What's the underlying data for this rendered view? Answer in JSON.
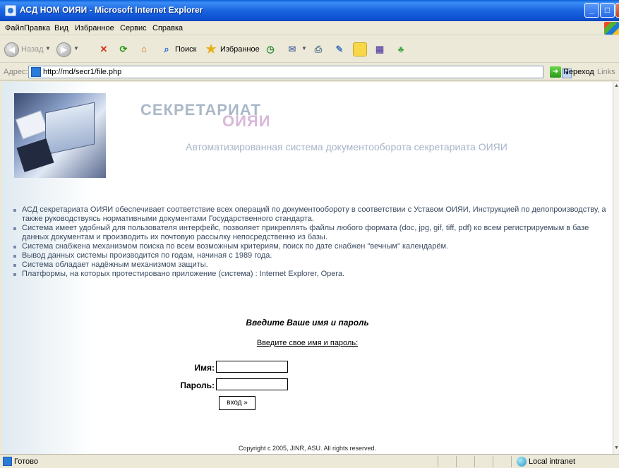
{
  "window": {
    "title": "АСД НОМ ОИЯИ - Microsoft Internet Explorer"
  },
  "menu": {
    "items": [
      "Файл",
      "Правка",
      "Вид",
      "Избранное",
      "Сервис",
      "Справка"
    ]
  },
  "toolbar": {
    "back_label": "Назад",
    "search_label": "Поиск",
    "favorites_label": "Избранное"
  },
  "address": {
    "label": "Адрес:",
    "url": "http://md/secr1/file.php",
    "go_label": "Переход",
    "links_label": "Links"
  },
  "page": {
    "banner_title": "СЕКРЕТАРИАТ",
    "banner_subtitle": "ОИЯИ",
    "banner_description": "Автоматизированная система документооборота секретариата ОИЯИ",
    "features": [
      "АСД секретариата ОИЯИ обеспечивает соответствие всех операций по документообороту в соответствии с Уставом ОИЯИ, Инструкцией по делопроизводству, а также руководствуясь нормативными документами Государственного стандарта.",
      "Система имеет удобный для пользователя интерфейс, позволяет прикреплять файлы любого формата (doc, jpg, gif, tiff, pdf) ко всем регистрируемым в базе данных документам и производить их почтовую рассылку непосредственно из базы.",
      "Система снабжена механизмом поиска по всем возможным критериям, поиск по дате снабжен \"вечным\" календарём.",
      "Вывод данных системы производится по годам, начиная с 1989 года.",
      "Система обладает надёжным механизмом защиты.",
      "Платформы, на которых протестировано приложение (система) : Internet Explorer, Opera."
    ],
    "login_heading": "Введите Ваше имя и пароль",
    "login_prompt": "Введите свое имя и пароль:",
    "name_label": "Имя:",
    "password_label": "Пароль:",
    "name_value": "",
    "password_value": "",
    "login_button": "вход »",
    "copyright": "Copyright c 2005, JINR, ASU. All rights reserved."
  },
  "status": {
    "text": "Готово",
    "zone": "Local intranet"
  }
}
